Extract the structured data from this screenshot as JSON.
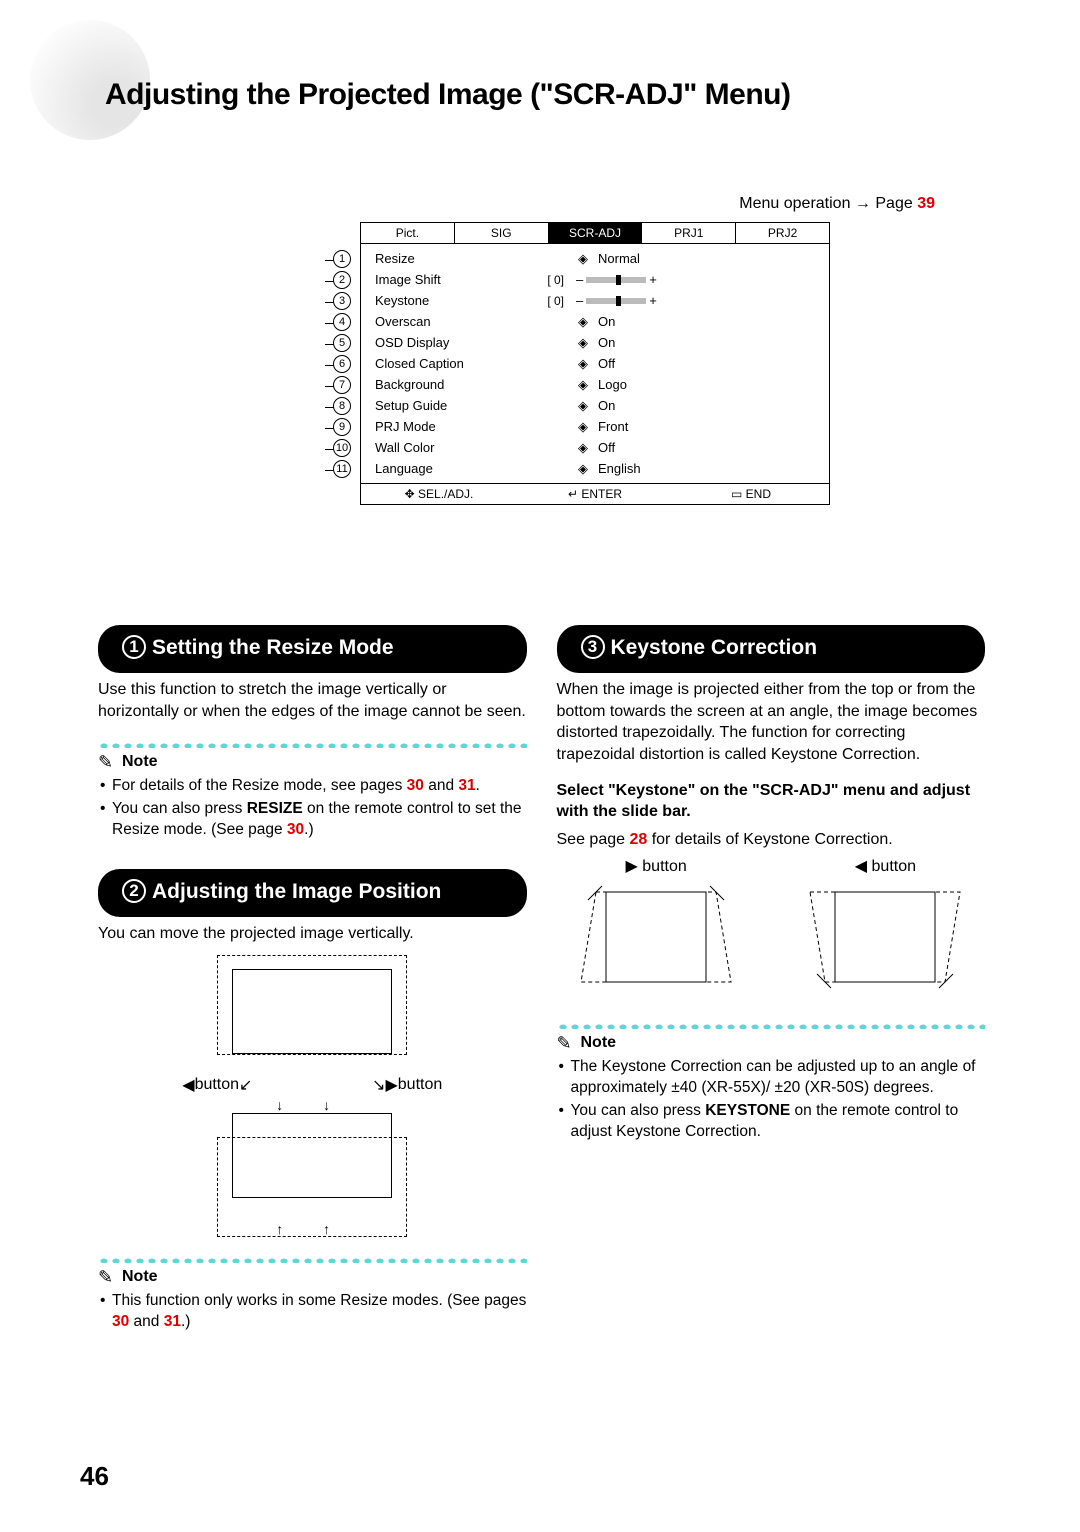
{
  "page_title": "Adjusting the Projected Image (\"SCR-ADJ\" Menu)",
  "menu_op_label": "Menu operation",
  "menu_op_prefix": "Page",
  "menu_op_pageref": "39",
  "tabs": [
    "Pict.",
    "SIG",
    "SCR-ADJ",
    "PRJ1",
    "PRJ2"
  ],
  "active_tab_index": 2,
  "menu_items": [
    {
      "num": "1",
      "name": "Resize",
      "mid": "",
      "arrow": true,
      "value": "Normal"
    },
    {
      "num": "2",
      "name": "Image Shift",
      "mid": "[    0]",
      "arrow": false,
      "slider": true,
      "left_sym": "–",
      "right_sym": "+"
    },
    {
      "num": "3",
      "name": "Keystone",
      "mid": "[    0]",
      "arrow": false,
      "slider": true,
      "left_sym": "–",
      "right_sym": "+"
    },
    {
      "num": "4",
      "name": "Overscan",
      "mid": "",
      "arrow": true,
      "value": "On"
    },
    {
      "num": "5",
      "name": "OSD Display",
      "mid": "",
      "arrow": true,
      "value": "On"
    },
    {
      "num": "6",
      "name": "Closed Caption",
      "mid": "",
      "arrow": true,
      "value": "Off"
    },
    {
      "num": "7",
      "name": "Background",
      "mid": "",
      "arrow": true,
      "value": "Logo"
    },
    {
      "num": "8",
      "name": "Setup Guide",
      "mid": "",
      "arrow": true,
      "value": "On"
    },
    {
      "num": "9",
      "name": "PRJ Mode",
      "mid": "",
      "arrow": true,
      "value": "Front"
    },
    {
      "num": "10",
      "name": "Wall Color",
      "mid": "",
      "arrow": true,
      "value": "Off"
    },
    {
      "num": "11",
      "name": "Language",
      "mid": "",
      "arrow": true,
      "value": "English"
    }
  ],
  "menu_foot": {
    "sel": "SEL./ADJ.",
    "enter": "ENTER",
    "end": "END"
  },
  "section1": {
    "num": "1",
    "title": "Setting the Resize Mode",
    "para": "Use this function to stretch the image vertically or horizontally or when the edges of the image cannot be seen.",
    "note_label": "Note",
    "notes": [
      {
        "pre": "For details of the Resize mode, see pages ",
        "ref1": "30",
        "mid": " and ",
        "ref2": "31",
        "post": "."
      },
      {
        "pre": "You can also press ",
        "bold": "RESIZE",
        "post": " on the remote control to set the Resize mode. (See page ",
        "ref": "30",
        "tail": ".)"
      }
    ]
  },
  "section2": {
    "num": "2",
    "title": "Adjusting the Image Position",
    "para": "You can move the projected image vertically.",
    "button_left": "button",
    "button_right": "button",
    "note_label": "Note",
    "notes": [
      {
        "pre": "This function only works in some Resize modes. (See pages ",
        "ref1": "30",
        "mid": " and ",
        "ref2": "31",
        "post": ".)"
      }
    ]
  },
  "section3": {
    "num": "3",
    "title": "Keystone Correction",
    "para": "When the image is projected either from the top or from the bottom towards the screen at an angle, the image becomes distorted trapezoidally. The function for correcting trapezoidal distortion is called Keystone Correction.",
    "bold_line": "Select \"Keystone\" on the \"SCR-ADJ\" menu and adjust with the slide bar.",
    "see_line_pre": "See page ",
    "see_line_ref": "28",
    "see_line_post": " for details of Keystone Correction.",
    "button_right_label": "button",
    "button_left_label": "button",
    "note_label": "Note",
    "notes": [
      {
        "text": "The Keystone Correction can be adjusted up to an angle of approximately ±40 (XR-55X)/ ±20 (XR-50S) degrees."
      },
      {
        "pre": "You can also press ",
        "bold": "KEYSTONE",
        "post": " on the remote control to adjust Keystone Correction."
      }
    ]
  },
  "page_number": "46"
}
